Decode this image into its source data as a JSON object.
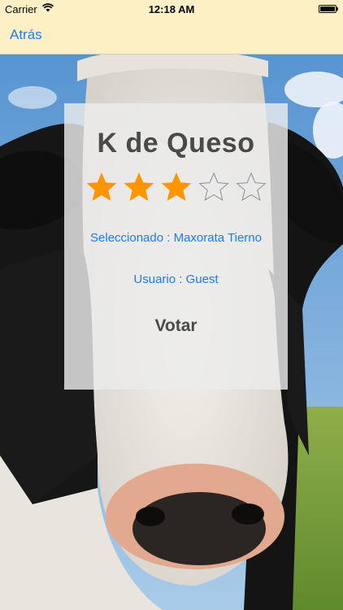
{
  "status_bar": {
    "carrier": "Carrier",
    "time": "12:18 AM"
  },
  "nav": {
    "back_label": "Atrás"
  },
  "card": {
    "title": "K de Queso",
    "rating": 3,
    "rating_max": 5,
    "selected": "Seleccionado : Maxorata Tierno",
    "user": "Usuario : Guest",
    "vote_label": "Votar"
  },
  "colors": {
    "accent": "#1a7cf5",
    "star_filled": "#ff9500",
    "nav_background": "#fdf0c4"
  },
  "icons": {
    "wifi": "wifi-icon",
    "battery": "battery-icon",
    "star_filled": "star-filled-icon",
    "star_empty": "star-outline-icon"
  }
}
